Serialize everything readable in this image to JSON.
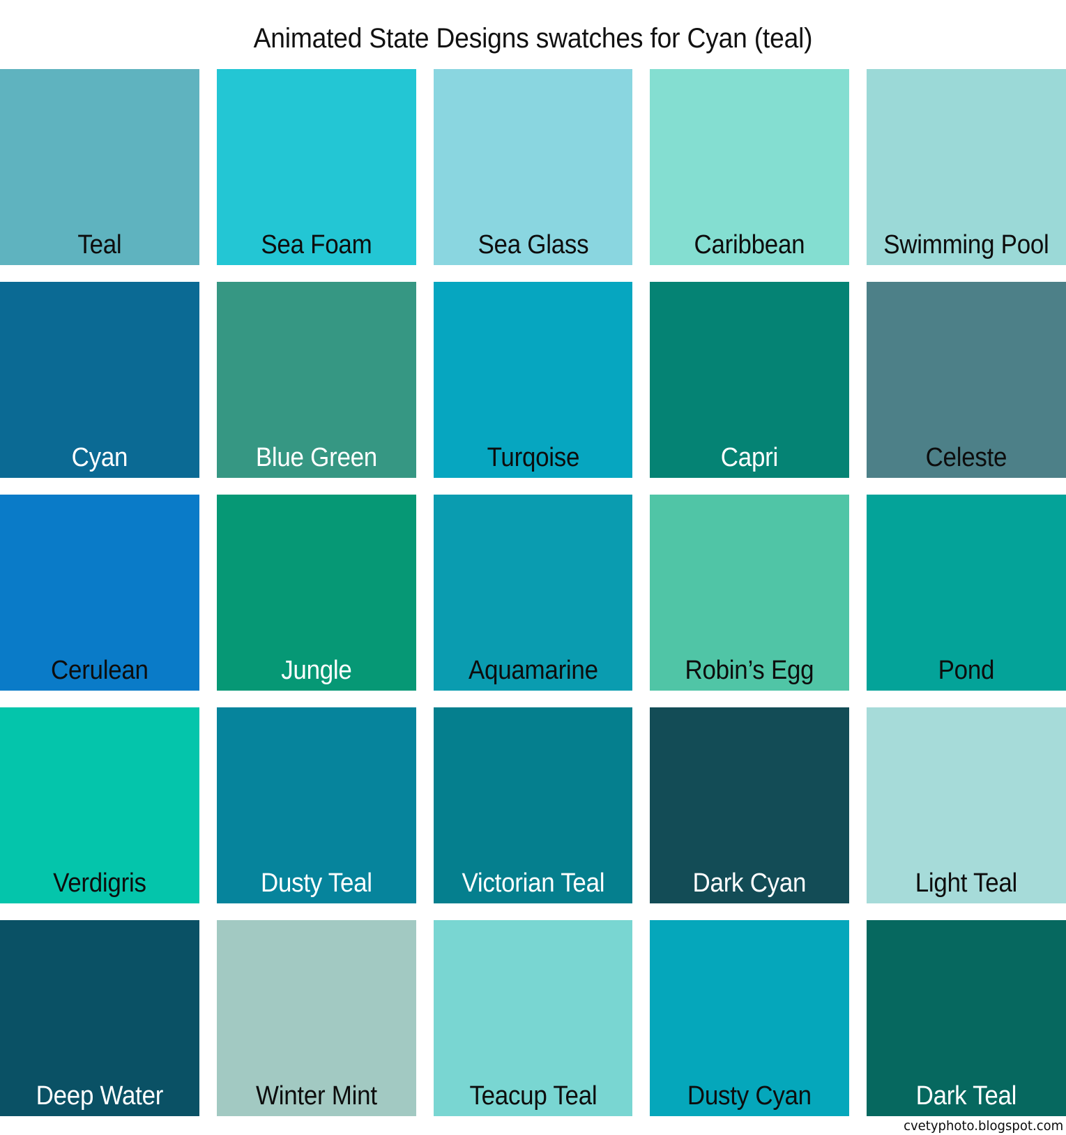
{
  "title": "Animated State Designs swatches for Cyan (teal)",
  "watermark": "cvetyphoto.blogspot.com",
  "grid": {
    "columns": 5,
    "rows": 5
  },
  "swatches": [
    {
      "name": "Teal",
      "color": "#5fb3bf",
      "label_color": "#0d0d0d",
      "row": 1,
      "col": 1
    },
    {
      "name": "Sea Foam",
      "color": "#23c6d4",
      "label_color": "#0d0d0d",
      "row": 1,
      "col": 2
    },
    {
      "name": "Sea Glass",
      "color": "#8ad6e0",
      "label_color": "#0d0d0d",
      "row": 1,
      "col": 3
    },
    {
      "name": "Caribbean",
      "color": "#84ded1",
      "label_color": "#0d0d0d",
      "row": 1,
      "col": 4
    },
    {
      "name": "Swimming Pool",
      "color": "#9bd9d7",
      "label_color": "#0d0d0d",
      "row": 1,
      "col": 5
    },
    {
      "name": "Cyan",
      "color": "#0b6a94",
      "label_color": "#ffffff",
      "row": 2,
      "col": 1
    },
    {
      "name": "Blue Green",
      "color": "#369783",
      "label_color": "#ffffff",
      "row": 2,
      "col": 2
    },
    {
      "name": "Turqoise",
      "color": "#06a6c0",
      "label_color": "#0d0d0d",
      "row": 2,
      "col": 3
    },
    {
      "name": "Capri",
      "color": "#058374",
      "label_color": "#ffffff",
      "row": 2,
      "col": 4
    },
    {
      "name": "Celeste",
      "color": "#4d8088",
      "label_color": "#0d0d0d",
      "row": 2,
      "col": 5
    },
    {
      "name": "Cerulean",
      "color": "#0a7bc8",
      "label_color": "#0d0d0d",
      "row": 3,
      "col": 1
    },
    {
      "name": "Jungle",
      "color": "#069875",
      "label_color": "#ffffff",
      "row": 3,
      "col": 2
    },
    {
      "name": "Aquamarine",
      "color": "#0a9cb0",
      "label_color": "#0d0d0d",
      "row": 3,
      "col": 3
    },
    {
      "name": "Robin’s Egg",
      "color": "#50c5a6",
      "label_color": "#0d0d0d",
      "row": 3,
      "col": 4
    },
    {
      "name": "Pond",
      "color": "#04a399",
      "label_color": "#0d0d0d",
      "row": 3,
      "col": 5
    },
    {
      "name": "Verdigris",
      "color": "#04c5ab",
      "label_color": "#0d0d0d",
      "row": 4,
      "col": 1
    },
    {
      "name": "Dusty Teal",
      "color": "#06849c",
      "label_color": "#ffffff",
      "row": 4,
      "col": 2
    },
    {
      "name": "Victorian Teal",
      "color": "#057f8e",
      "label_color": "#ffffff",
      "row": 4,
      "col": 3
    },
    {
      "name": "Dark Cyan",
      "color": "#134c56",
      "label_color": "#ffffff",
      "row": 4,
      "col": 4
    },
    {
      "name": "Light Teal",
      "color": "#a6dbd9",
      "label_color": "#0d0d0d",
      "row": 4,
      "col": 5
    },
    {
      "name": "Deep Water",
      "color": "#0a5165",
      "label_color": "#ffffff",
      "row": 5,
      "col": 1
    },
    {
      "name": "Winter Mint",
      "color": "#a2c9c2",
      "label_color": "#0d0d0d",
      "row": 5,
      "col": 2
    },
    {
      "name": "Teacup Teal",
      "color": "#79d6d2",
      "label_color": "#0d0d0d",
      "row": 5,
      "col": 3
    },
    {
      "name": "Dusty Cyan",
      "color": "#05a7bb",
      "label_color": "#0d0d0d",
      "row": 5,
      "col": 4
    },
    {
      "name": "Dark Teal",
      "color": "#06685f",
      "label_color": "#ffffff",
      "row": 5,
      "col": 5
    }
  ]
}
